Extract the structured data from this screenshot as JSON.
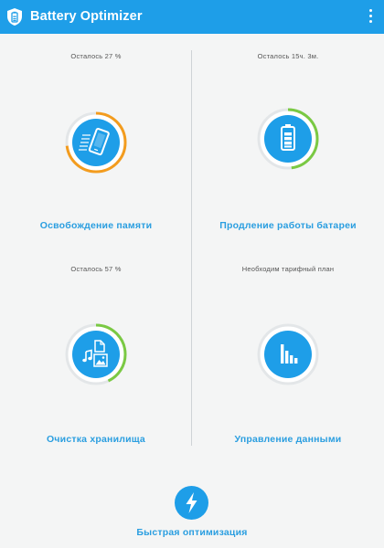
{
  "app": {
    "title": "Battery Optimizer",
    "icon": "battery-shield-icon",
    "menu_icon": "overflow-menu-icon"
  },
  "colors": {
    "appbar": "#1e9ee8",
    "accent_blue": "#2a9ee0",
    "ring_orange": "#f39c1e",
    "ring_green": "#7ac943",
    "ring_track": "#e3e6e8",
    "background": "#f4f5f5"
  },
  "tiles": [
    {
      "id": "memory",
      "status": "Осталось 27 %",
      "label": "Освобождение памяти",
      "icon": "phone-clean-icon",
      "ring_color": "orange",
      "ring_fraction": 0.73
    },
    {
      "id": "battery",
      "status": "Осталось 15ч. 3м.",
      "label": "Продление работы батареи",
      "icon": "battery-icon",
      "ring_color": "green",
      "ring_fraction": 0.48
    },
    {
      "id": "storage",
      "status": "Осталось 57 %",
      "label": "Очистка хранилища",
      "icon": "media-files-icon",
      "ring_color": "green",
      "ring_fraction": 0.43
    },
    {
      "id": "data",
      "status": "Необходим тарифный план",
      "label": "Управление данными",
      "icon": "bar-chart-icon",
      "ring_color": "none",
      "ring_fraction": 0
    }
  ],
  "quick": {
    "label": "Быстрая оптимизация",
    "icon": "lightning-icon"
  }
}
